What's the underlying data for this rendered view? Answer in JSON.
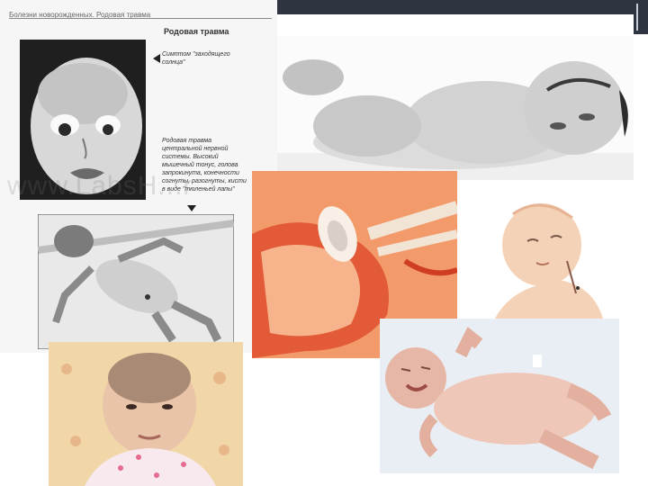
{
  "scan_page": {
    "header": "Болезни новорожденных. Родовая травма",
    "title": "Родовая травма",
    "caption_sunset": "Симптом \"заходящего солнца\"",
    "caption_spastic": "Родовая травма центральной нервной системы. Высокий мышечный тонус, голова запрокинута, конечности согнуты, разогнуты, кисти в виде \"тюленьей лапы\"",
    "watermark": "www.LabsH...r"
  },
  "icons": {
    "left_arrow": "arrow-left-icon",
    "down_arrow": "arrow-down-icon"
  },
  "colors": {
    "slide_bar": "#2f3540",
    "birth_canal": "#f39a6a",
    "nursery_bg": "#f1d7a8"
  }
}
